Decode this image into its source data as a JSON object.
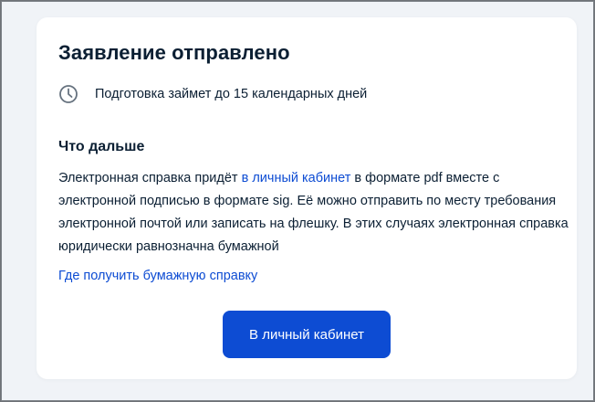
{
  "card": {
    "title": "Заявление отправлено",
    "duration": {
      "icon": "clock-icon",
      "text": "Подготовка займет до 15 календарных дней"
    },
    "next": {
      "heading": "Что дальше",
      "paragraph_before_link": "Электронная справка придёт ",
      "paragraph_link": "в личный кабинет",
      "paragraph_after_link": " в формате pdf вместе с электронной подписью в формате sig. Её можно отправить по месту требования электронной почтой или записать на флешку. В этих случаях электронная справка юридически равнозначна бумажной"
    },
    "paper_link": "Где получить бумажную справку",
    "primary_button": "В личный кабинет"
  },
  "colors": {
    "page_background": "#f0f3f7",
    "card_background": "#ffffff",
    "text": "#0b1f33",
    "link": "#0d4cd3",
    "button_background": "#0d4cd3",
    "button_text": "#ffffff",
    "icon": "#66727f"
  }
}
